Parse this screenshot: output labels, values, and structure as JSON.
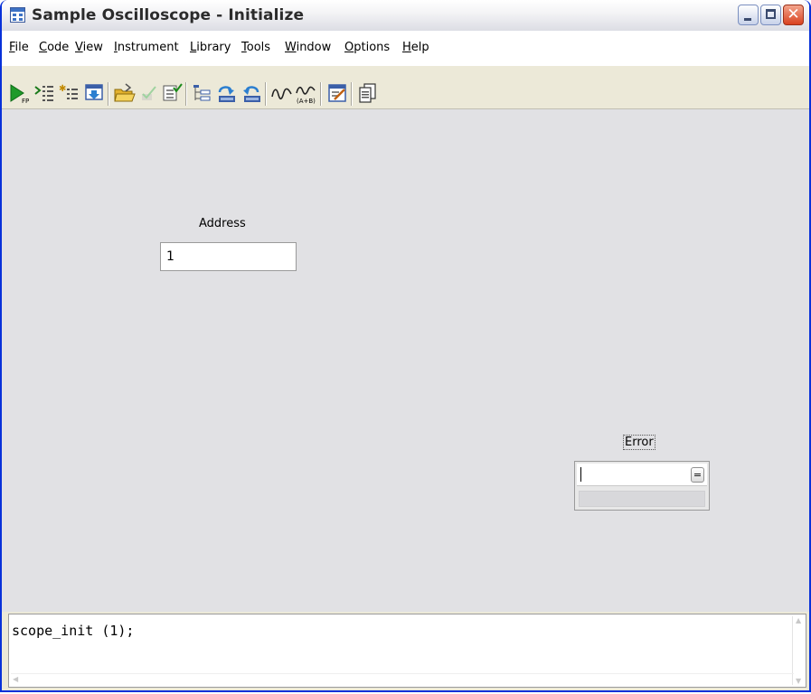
{
  "window": {
    "title": "Sample Oscilloscope - Initialize",
    "close_glyph": "✕"
  },
  "menu": [
    {
      "key": "F",
      "rest": "ile"
    },
    {
      "key": "C",
      "rest": "ode"
    },
    {
      "key": "V",
      "rest": "iew"
    },
    {
      "key": "I",
      "rest": "nstrument"
    },
    {
      "key": "L",
      "rest": "ibrary"
    },
    {
      "key": "T",
      "rest": "ools"
    },
    {
      "key": "W",
      "rest": "indow"
    },
    {
      "key": "O",
      "rest": "ptions"
    },
    {
      "key": "H",
      "rest": "elp"
    }
  ],
  "toolbar": {
    "icons": [
      "run-icon",
      "add-function-icon",
      "add-variable-icon",
      "goto-icon",
      "open-folder-icon",
      "edit-checked-icon",
      "check-list-icon",
      "tree-view-icon",
      "upload-icon",
      "download-icon",
      "waveform-icon",
      "waveform-ab-icon",
      "edit-panel-icon",
      "copy-icon"
    ],
    "run_suffix": "FP",
    "wave_ab_text": "(A+B)"
  },
  "panel": {
    "address": {
      "label": "Address",
      "value": "1"
    },
    "error": {
      "label": "Error",
      "button": "="
    }
  },
  "code": {
    "text": "scope_init (1);"
  },
  "colors": {
    "title_blue": "#0831d9",
    "panel_bg": "#e1e1e4",
    "close_red": "#d9421f"
  }
}
